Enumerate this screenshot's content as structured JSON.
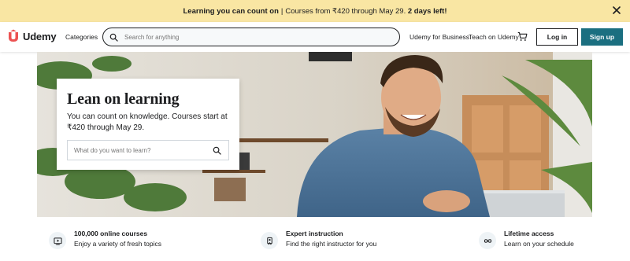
{
  "promo": {
    "lead": "Learning you can count on",
    "separator": "|",
    "body": "Courses from ₹420 through May 29.",
    "emphasis": "2 days left!"
  },
  "header": {
    "logo_text": "Udemy",
    "categories": "Categories",
    "search_placeholder": "Search for anything",
    "business": "Udemy for Business",
    "teach": "Teach on Udemy",
    "login": "Log in",
    "signup": "Sign up"
  },
  "hero": {
    "title": "Lean on learning",
    "subtitle": "You can count on knowledge. Courses start at ₹420 through May 29.",
    "search_placeholder": "What do you want to learn?"
  },
  "features": [
    {
      "icon": "video-icon",
      "title": "100,000 online courses",
      "subtitle": "Enjoy a variety of fresh topics"
    },
    {
      "icon": "instructor-icon",
      "title": "Expert instruction",
      "subtitle": "Find the right instructor for you"
    },
    {
      "icon": "infinity-icon",
      "title": "Lifetime access",
      "subtitle": "Learn on your schedule"
    }
  ],
  "colors": {
    "promo_bg": "#f9e6a3",
    "brand": "#ec5252",
    "signup_bg": "#1b6f80",
    "text": "#1c1d1f"
  }
}
